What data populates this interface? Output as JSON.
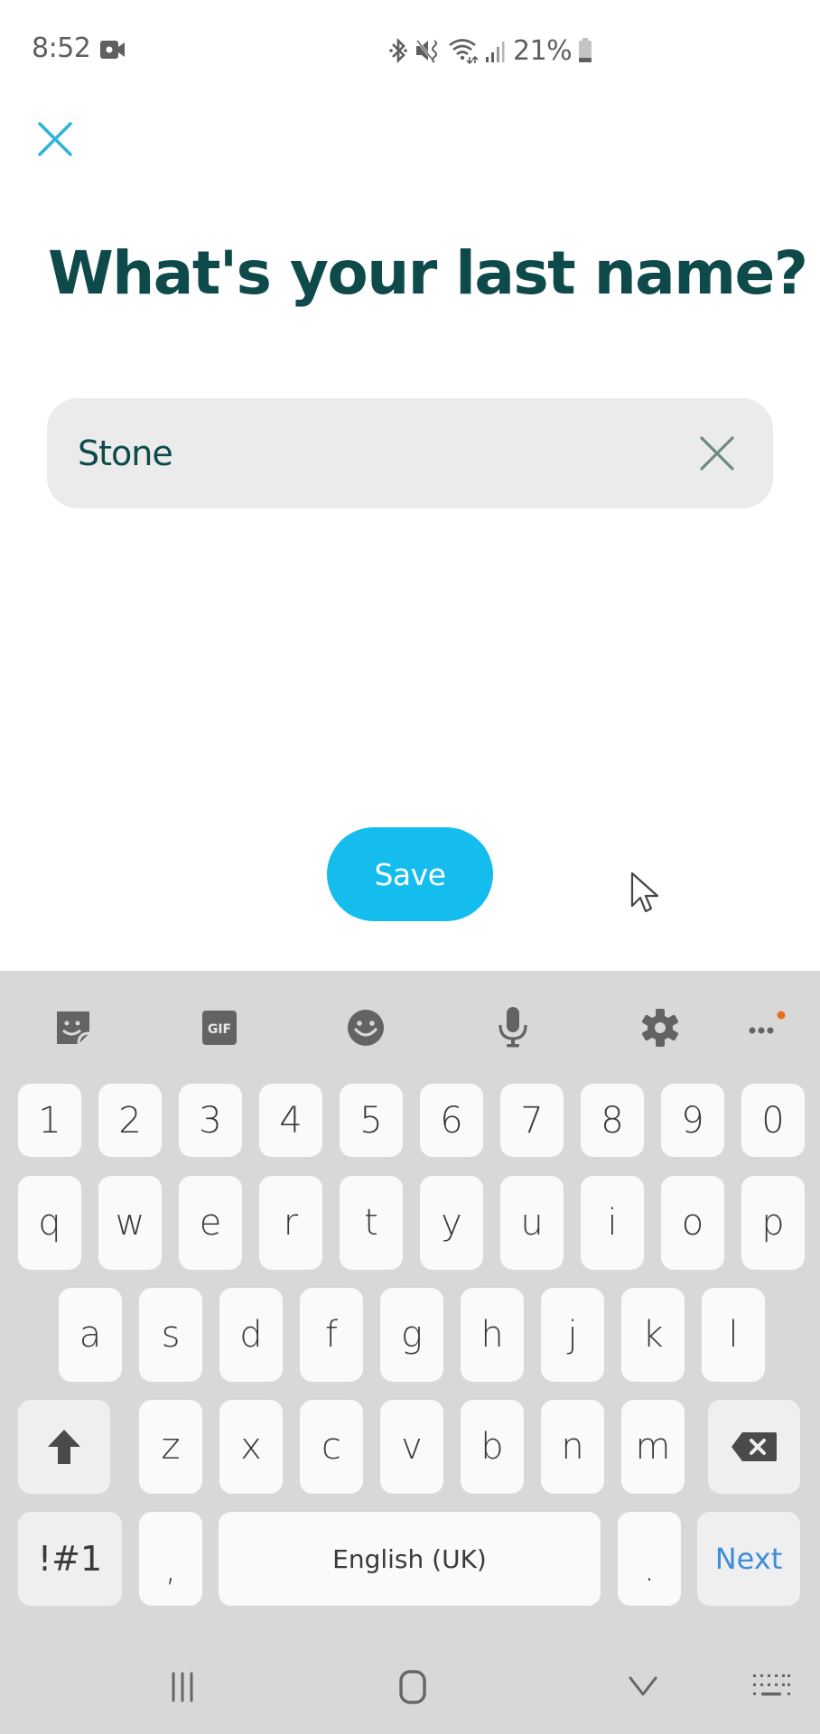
{
  "status_bar": {
    "time": "8:52",
    "battery_percent": "21%",
    "battery_level": 0.21,
    "icons": [
      "screen-record-icon",
      "bluetooth-icon",
      "vibrate-mute-icon",
      "wifi-icon",
      "signal-icon",
      "battery-icon"
    ]
  },
  "header": {
    "close_icon": "close-icon"
  },
  "page": {
    "title": "What's your last name?"
  },
  "form": {
    "last_name": {
      "value": "Stone",
      "clear_icon": "clear-icon"
    },
    "save_label": "Save"
  },
  "colors": {
    "title": "#0f4a4b",
    "accent": "#14bdee",
    "close_icon": "#2bb5d8",
    "input_bg": "#ebebeb",
    "keyboard_bg": "#d8d8d8",
    "next_key": "#3d8ddb",
    "notification_dot": "#e8701a"
  },
  "keyboard": {
    "language": "English (UK)",
    "toolbar": [
      {
        "name": "sticker-icon"
      },
      {
        "name": "gif-icon",
        "label": "GIF"
      },
      {
        "name": "emoji-icon"
      },
      {
        "name": "microphone-icon"
      },
      {
        "name": "settings-icon"
      },
      {
        "name": "more-icon"
      }
    ],
    "rows": [
      [
        "1",
        "2",
        "3",
        "4",
        "5",
        "6",
        "7",
        "8",
        "9",
        "0"
      ],
      [
        "q",
        "w",
        "e",
        "r",
        "t",
        "y",
        "u",
        "i",
        "o",
        "p"
      ],
      [
        "a",
        "s",
        "d",
        "f",
        "g",
        "h",
        "j",
        "k",
        "l"
      ],
      [
        "z",
        "x",
        "c",
        "v",
        "b",
        "n",
        "m"
      ]
    ],
    "shift_icon": "shift-icon",
    "backspace_icon": "backspace-icon",
    "symbols_label": "!#1",
    "comma_label": ",",
    "period_label": ".",
    "action_label": "Next"
  },
  "nav_bar": {
    "buttons": [
      "recents-icon",
      "home-icon",
      "back-icon",
      "keyboard-switch-icon"
    ]
  }
}
